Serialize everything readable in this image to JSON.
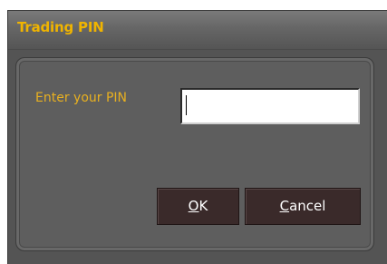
{
  "dialog": {
    "title": "Trading PIN",
    "pin_label": "Enter your PIN",
    "pin_value": "",
    "ok": {
      "mnemonic": "O",
      "rest": "K"
    },
    "cancel": {
      "mnemonic": "C",
      "rest": "ancel"
    }
  },
  "colors": {
    "title": "#f0b400",
    "label": "#e8b020",
    "window_bg": "#545454",
    "button_bg": "#3a2a2a"
  }
}
